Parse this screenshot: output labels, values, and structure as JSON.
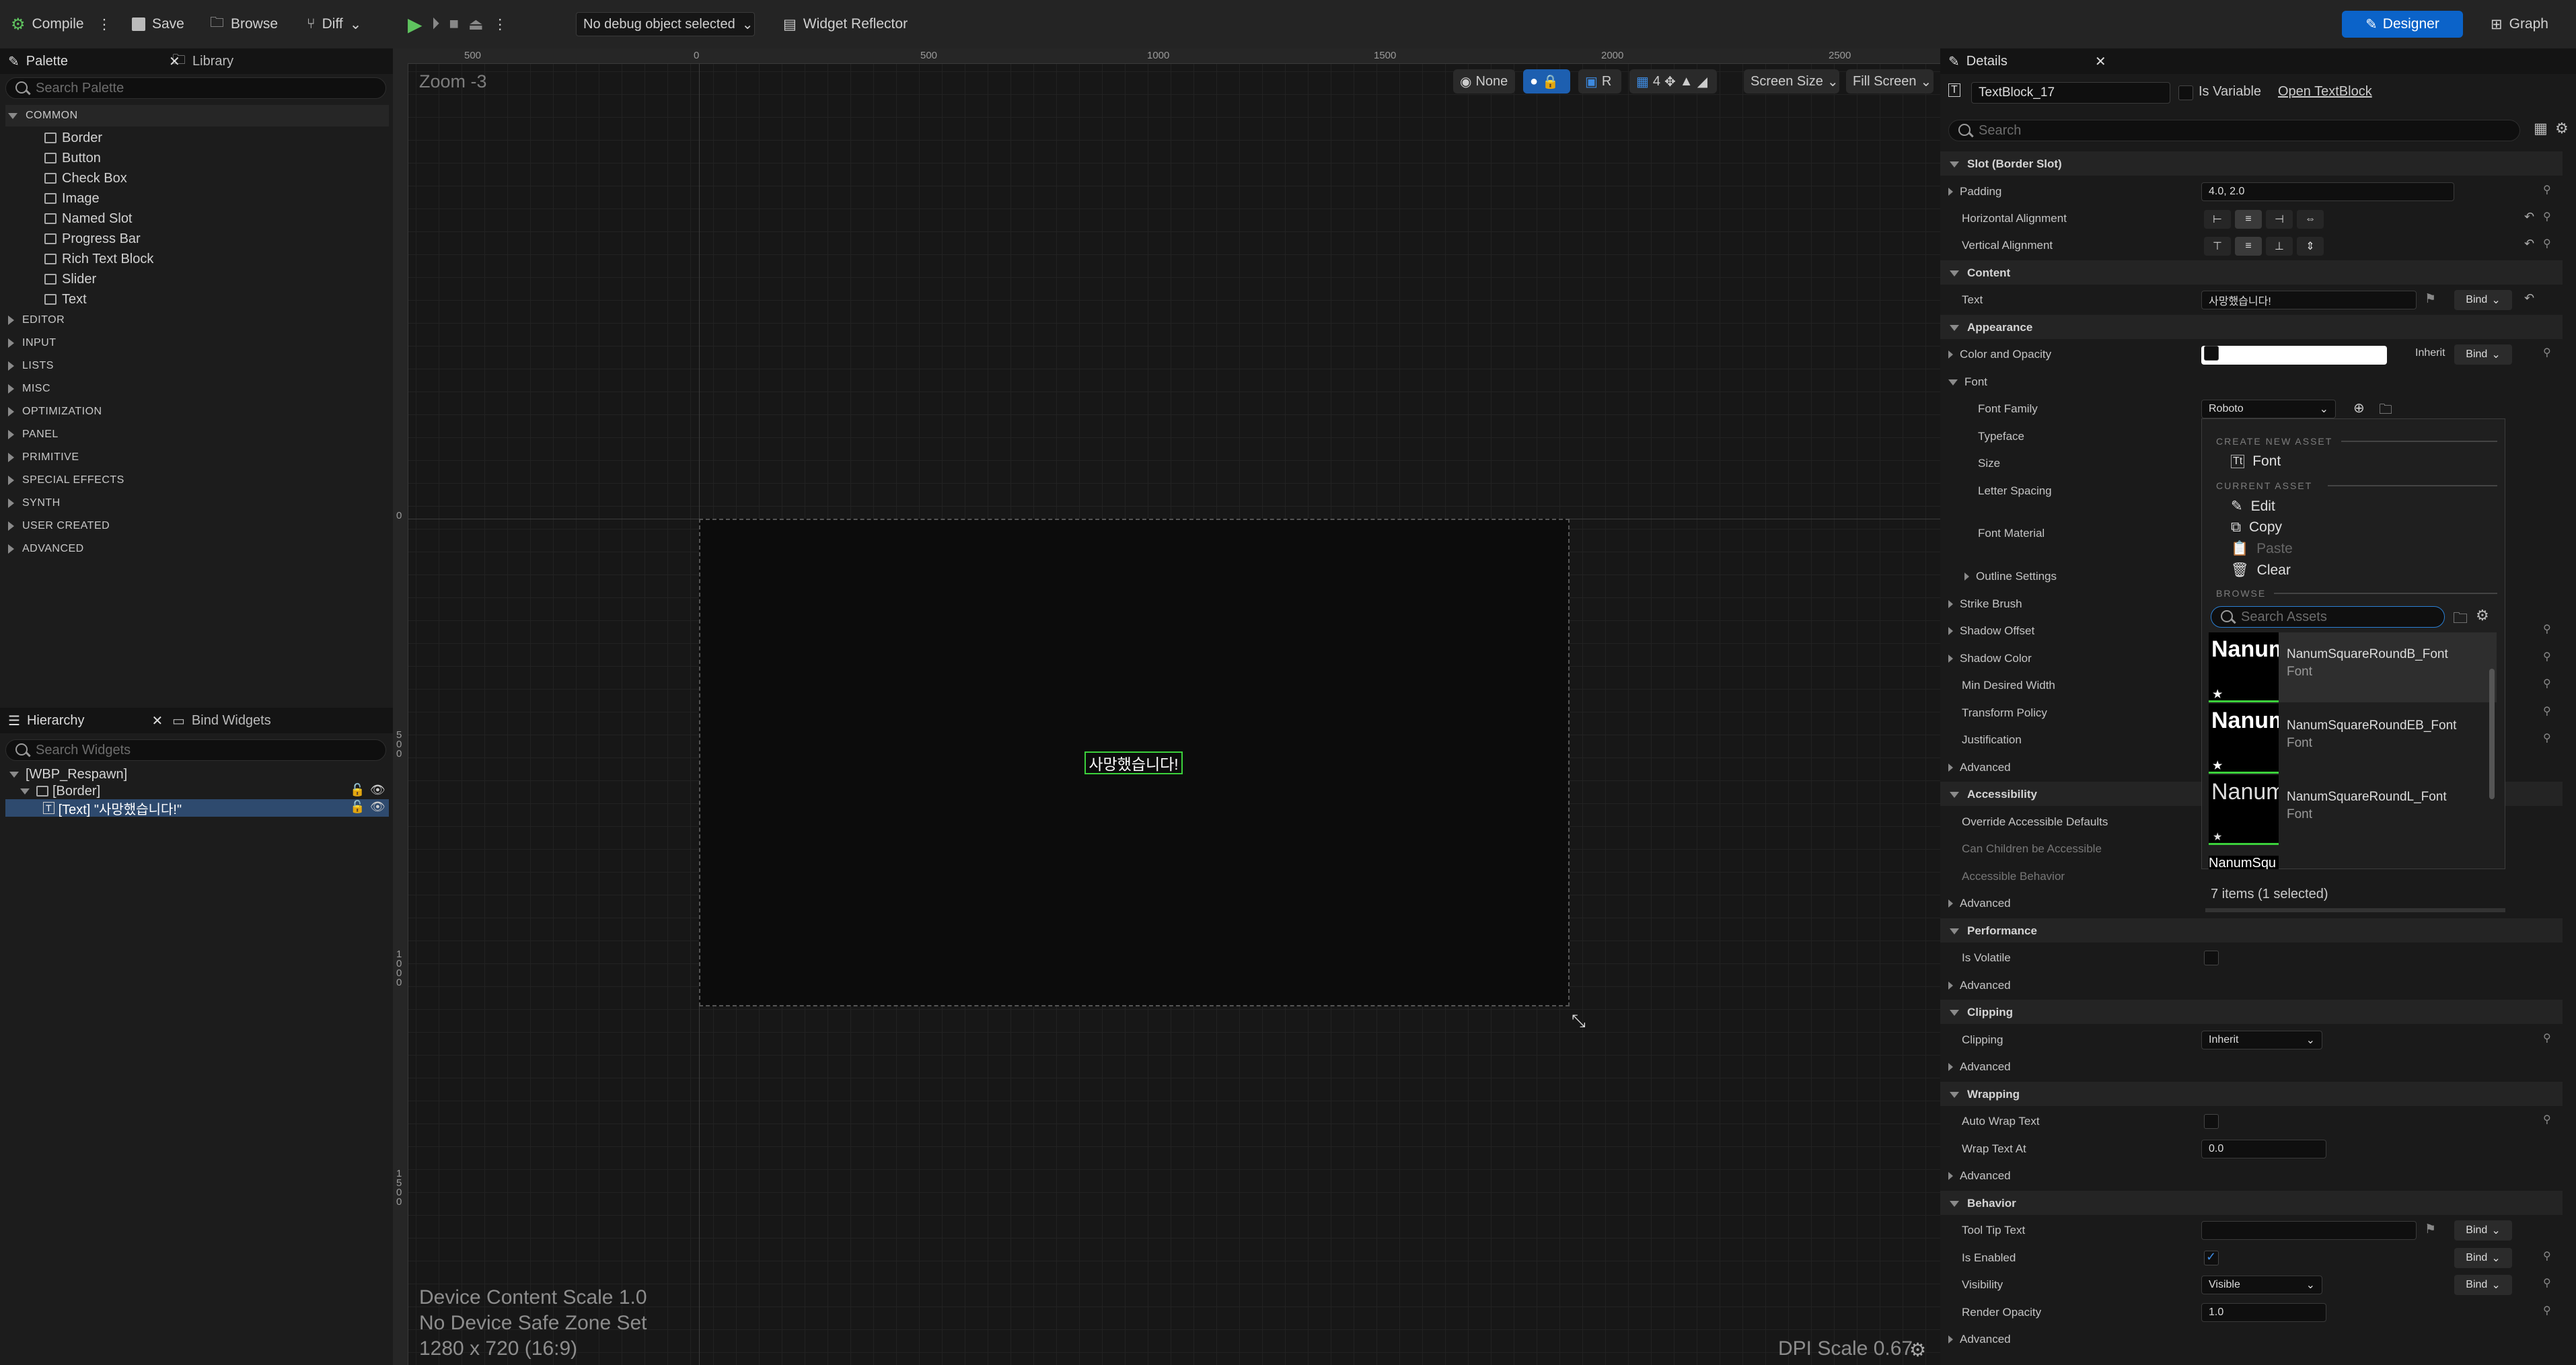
{
  "toolbar": {
    "compile": "Compile",
    "save": "Save",
    "browse": "Browse",
    "diff": "Diff",
    "debug_select": "No debug object selected",
    "widget_reflector": "Widget Reflector",
    "designer": "Designer",
    "graph": "Graph"
  },
  "palette": {
    "tab": "Palette",
    "library_tab": "Library",
    "search_placeholder": "Search Palette",
    "common_label": "COMMON",
    "common_items": [
      "Border",
      "Button",
      "Check Box",
      "Image",
      "Named Slot",
      "Progress Bar",
      "Rich Text Block",
      "Slider",
      "Text"
    ],
    "categories": [
      "EDITOR",
      "INPUT",
      "LISTS",
      "MISC",
      "OPTIMIZATION",
      "PANEL",
      "PRIMITIVE",
      "SPECIAL EFFECTS",
      "SYNTH",
      "USER CREATED",
      "ADVANCED"
    ]
  },
  "hierarchy": {
    "tab": "Hierarchy",
    "bind_tab": "Bind Widgets",
    "search_placeholder": "Search Widgets",
    "root": "[WBP_Respawn]",
    "border": "[Border]",
    "text": "[Text] \"사망했습니다!\""
  },
  "viewport": {
    "zoom": "Zoom -3",
    "none": "None",
    "r": "R",
    "grid_val": "4",
    "screen_size": "Screen Size",
    "fill_screen": "Fill Screen",
    "ruler_h": [
      "500",
      "0",
      "500",
      "1000",
      "1500",
      "2000",
      "2500"
    ],
    "ruler_v": [
      "0",
      "500",
      "1000",
      "1500"
    ],
    "text_widget": "사망했습니다!",
    "device_scale": "Device Content Scale 1.0",
    "safe_zone": "No Device Safe Zone Set",
    "resolution": "1280 x 720 (16:9)",
    "dpi": "DPI Scale 0.67"
  },
  "details": {
    "tab": "Details",
    "widget_name": "TextBlock_17",
    "is_variable": "Is Variable",
    "open": "Open TextBlock",
    "search_placeholder": "Search",
    "sections": {
      "slot": "Slot (Border Slot)",
      "content": "Content",
      "appearance": "Appearance",
      "accessibility": "Accessibility",
      "performance": "Performance",
      "clipping": "Clipping",
      "wrapping": "Wrapping",
      "behavior": "Behavior"
    },
    "props": {
      "padding": "Padding",
      "padding_val": "4.0, 2.0",
      "h_align": "Horizontal Alignment",
      "v_align": "Vertical Alignment",
      "text": "Text",
      "text_val": "사망했습니다!",
      "color_opacity": "Color and Opacity",
      "inherit": "Inherit",
      "font": "Font",
      "font_family": "Font Family",
      "font_family_val": "Roboto",
      "typeface": "Typeface",
      "size": "Size",
      "letter_spacing": "Letter Spacing",
      "font_material": "Font Material",
      "outline": "Outline Settings",
      "strike": "Strike Brush",
      "shadow_offset": "Shadow Offset",
      "shadow_color": "Shadow Color",
      "min_width": "Min Desired Width",
      "transform_policy": "Transform Policy",
      "justification": "Justification",
      "advanced": "Advanced",
      "override_acc": "Override Accessible Defaults",
      "can_children": "Can Children be Accessible",
      "acc_behavior": "Accessible Behavior",
      "is_volatile": "Is Volatile",
      "clipping_label": "Clipping",
      "clipping_val": "Inherit",
      "auto_wrap": "Auto Wrap Text",
      "wrap_at": "Wrap Text At",
      "wrap_val": "0.0",
      "tooltip": "Tool Tip Text",
      "is_enabled": "Is Enabled",
      "visibility": "Visibility",
      "visibility_val": "Visible",
      "render_opacity": "Render Opacity",
      "render_val": "1.0",
      "bind": "Bind"
    }
  },
  "dropdown": {
    "create_head": "CREATE NEW ASSET",
    "font": "Font",
    "current_head": "CURRENT ASSET",
    "edit": "Edit",
    "copy": "Copy",
    "paste": "Paste",
    "clear": "Clear",
    "browse_head": "BROWSE",
    "search_placeholder": "Search Assets",
    "fonts": [
      {
        "preview": "Nanum",
        "name": "NanumSquareRoundB_Font",
        "type": "Font"
      },
      {
        "preview": "Nanum",
        "name": "NanumSquareRoundEB_Font",
        "type": "Font"
      },
      {
        "preview": "Nanum",
        "name": "NanumSquareRoundL_Font",
        "type": "Font"
      }
    ],
    "partial": "NanumSqu",
    "count": "7 items (1 selected)"
  }
}
